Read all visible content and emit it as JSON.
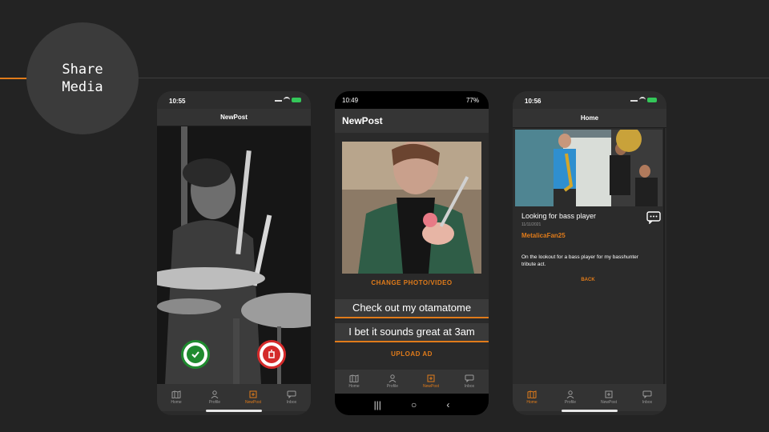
{
  "slide": {
    "title": "Share\nMedia",
    "accent_color": "#e07b1a"
  },
  "phone1": {
    "status": {
      "time": "10:55"
    },
    "app_title": "NewPost",
    "confirm_icon": "check-shield-icon",
    "discard_icon": "discard-icon",
    "tabs": [
      {
        "label": "Home",
        "icon": "map-icon",
        "active": false
      },
      {
        "label": "Profile",
        "icon": "person-icon",
        "active": false
      },
      {
        "label": "NewPost",
        "icon": "new-post-icon",
        "active": true
      },
      {
        "label": "Inbox",
        "icon": "chat-icon",
        "active": false
      }
    ]
  },
  "phone2": {
    "status": {
      "time": "10:49",
      "battery": "77%"
    },
    "app_title": "NewPost",
    "change_label": "CHANGE PHOTO/VIDEO",
    "caption_value": "Check out my otamatome",
    "description_value": "I bet it sounds great at 3am",
    "upload_label": "UPLOAD AD",
    "tabs": [
      {
        "label": "Home",
        "icon": "map-icon",
        "active": false
      },
      {
        "label": "Profile",
        "icon": "person-icon",
        "active": false
      },
      {
        "label": "NewPost",
        "icon": "new-post-icon",
        "active": true
      },
      {
        "label": "Inbox",
        "icon": "chat-icon",
        "active": false
      }
    ],
    "nav": {
      "recent": "|||",
      "home": "○",
      "back": "‹"
    }
  },
  "phone3": {
    "status": {
      "time": "10:56"
    },
    "app_title": "Home",
    "post": {
      "title": "Looking for bass player",
      "date": "11/11/2021",
      "user": "MetalicaFan25",
      "text": "On the lookout for a bass player for my basshunter tribute act.",
      "back_label": "BACK"
    },
    "tabs": [
      {
        "label": "Home",
        "icon": "map-icon",
        "active": true
      },
      {
        "label": "Profile",
        "icon": "person-icon",
        "active": false
      },
      {
        "label": "NewPost",
        "icon": "new-post-icon",
        "active": false
      },
      {
        "label": "Inbox",
        "icon": "chat-icon",
        "active": false
      }
    ]
  }
}
